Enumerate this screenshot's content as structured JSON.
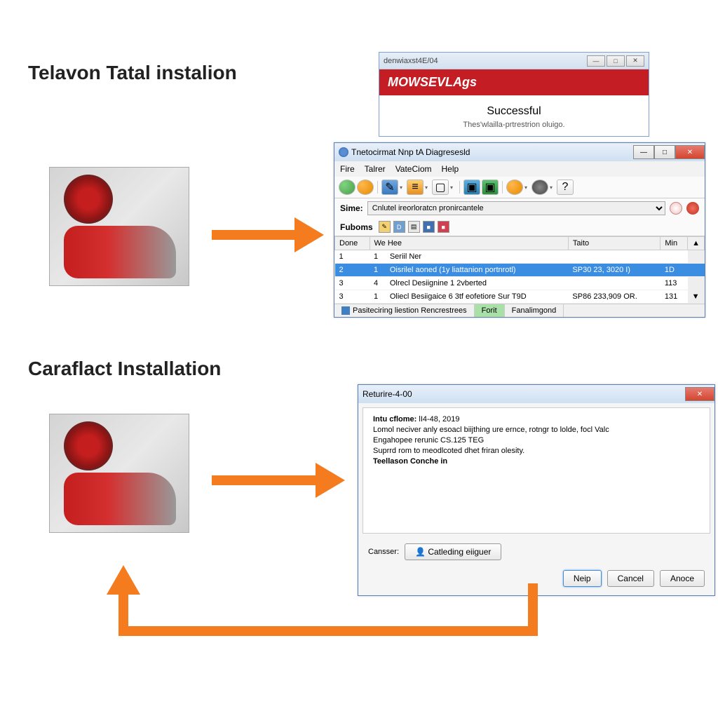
{
  "section1": {
    "title": "Telavon Tatal instalion"
  },
  "section2": {
    "title": "Caraflact Installation"
  },
  "win1": {
    "title": "denwiaxst4E/04",
    "header": "MOWSEVLAgs",
    "success_title": "Successful",
    "success_sub": "Thes'wlailla-prtrestrion oluigo."
  },
  "win2": {
    "title": "Tnetocirmat Nnp tA Diagresesld",
    "menu": {
      "file": "Fire",
      "talrer": "Talrer",
      "valecom": "VateCiom",
      "help": "Help"
    },
    "sime_label": "Sime:",
    "sime_value": "Cnlutel ireorloratcn pronircantele",
    "fub_label": "Fuboms",
    "table": {
      "headers": {
        "done": "Done",
        "wehee": "We Hee",
        "taito": "Taito",
        "min": "Min"
      },
      "rows": [
        {
          "c1": "1",
          "c2": "1",
          "c3": "Seriil Ner",
          "c4": "",
          "c5": ""
        },
        {
          "c1": "2",
          "c2": "1",
          "c3": "Oisrilel aoned (1y liattanion portnrotl)",
          "c4": "SP30 23, 3020 I)",
          "c5": "1D"
        },
        {
          "c1": "3",
          "c2": "4",
          "c3": "Olrecl Desiignine 1 2vberted",
          "c4": "",
          "c5": "113"
        },
        {
          "c1": "3",
          "c2": "1",
          "c3": "Oliecl Besiigaice 6 3tf eofetiore Sur T9D",
          "c4": "SP86 233,909 OR.",
          "c5": "131"
        }
      ]
    },
    "status": {
      "s1": "Pasiteciring liestion Rencrestrees",
      "s2": "Forit",
      "s3": "Fanalimgond"
    }
  },
  "win3": {
    "title": "Returire-4-00",
    "lines": {
      "l1a": "Intu cflome:",
      "l1b": "lI4-48, 2019",
      "l2": "Lomol neciver anly esoacl biijthing ure ernce, rotngr to lolde, focl Valc",
      "l3": "Engahopee rerunic CS.125 TEG",
      "l4": "Suprrd rom to meodlcoted dhet friran olesity.",
      "l5": "Teellason Conche in"
    },
    "cansser_label": "Cansser:",
    "catleding_btn": "Catleding eiiguer",
    "help_btn": "Neip",
    "cancel_btn": "Cancel",
    "anoce_btn": "Anoce"
  }
}
